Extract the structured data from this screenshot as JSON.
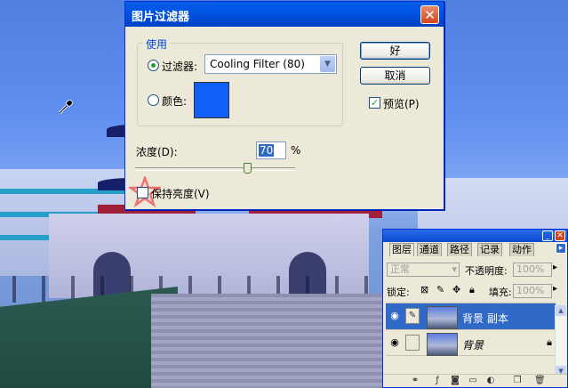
{
  "dialog": {
    "title": "图片过滤器",
    "close_label": "✕",
    "group_label": "使用",
    "filter_label": "过滤器:",
    "filter_value": "Cooling Filter (80)",
    "color_label": "颜色:",
    "color_swatch": "#1060f8",
    "ok_label": "好",
    "cancel_label": "取消",
    "preview_label": "预览(P)",
    "preview_checked": true,
    "density_label": "浓度(D):",
    "density_value": "70",
    "density_unit": "%",
    "density_percent": 70,
    "preserve_label": "保持亮度(V)",
    "preserve_checked": false
  },
  "layers_panel": {
    "tabs": [
      "图层",
      "通道",
      "路径",
      "记录",
      "动作"
    ],
    "blend_mode": "正常",
    "opacity_label": "不透明度:",
    "opacity_value": "100%",
    "lock_label": "锁定:",
    "fill_label": "填充:",
    "fill_value": "100%",
    "layers": [
      {
        "name": "背景 副本",
        "selected": true
      },
      {
        "name": "背景",
        "selected": false
      }
    ]
  },
  "icons": {
    "eyedropper": "eyedropper-icon",
    "eye": "eye-icon",
    "lock": "lock-icon",
    "brush": "brush-icon"
  }
}
